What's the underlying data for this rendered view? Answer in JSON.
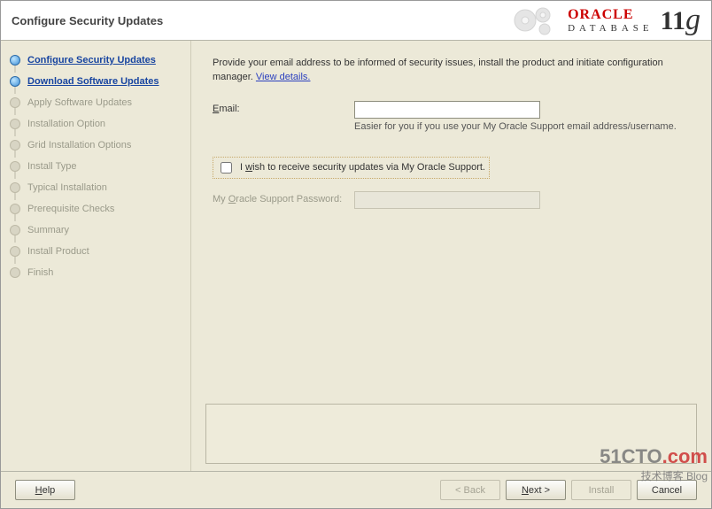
{
  "header": {
    "title": "Configure Security Updates",
    "brand_top": "ORACLE",
    "brand_bottom": "DATABASE",
    "brand_version": "11",
    "brand_version_suffix": "g"
  },
  "sidebar": {
    "items": [
      {
        "label": "Configure Security Updates",
        "state": "active"
      },
      {
        "label": "Download Software Updates",
        "state": "done"
      },
      {
        "label": "Apply Software Updates",
        "state": "pending"
      },
      {
        "label": "Installation Option",
        "state": "pending"
      },
      {
        "label": "Grid Installation Options",
        "state": "pending"
      },
      {
        "label": "Install Type",
        "state": "pending"
      },
      {
        "label": "Typical Installation",
        "state": "pending"
      },
      {
        "label": "Prerequisite Checks",
        "state": "pending"
      },
      {
        "label": "Summary",
        "state": "pending"
      },
      {
        "label": "Install Product",
        "state": "pending"
      },
      {
        "label": "Finish",
        "state": "pending"
      }
    ]
  },
  "main": {
    "instruction": "Provide your email address to be informed of security issues, install the product and initiate configuration manager. ",
    "view_details": "View details.",
    "email_label_pre": "E",
    "email_label_rest": "mail:",
    "email_value": "",
    "email_hint": "Easier for you if you use your My Oracle Support email address/username.",
    "checkbox_pre": "I ",
    "checkbox_u": "w",
    "checkbox_rest": "ish to receive security updates via My Oracle Support.",
    "checkbox_checked": false,
    "password_label_pre": "My ",
    "password_label_u": "O",
    "password_label_rest": "racle Support Password:",
    "password_value": ""
  },
  "footer": {
    "help": "Help",
    "back": "< Back",
    "next": "Next >",
    "install": "Install",
    "cancel": "Cancel"
  },
  "watermark": {
    "line1a": "51CTO",
    "line1b": ".com",
    "line2": "技术博客  Blog"
  }
}
